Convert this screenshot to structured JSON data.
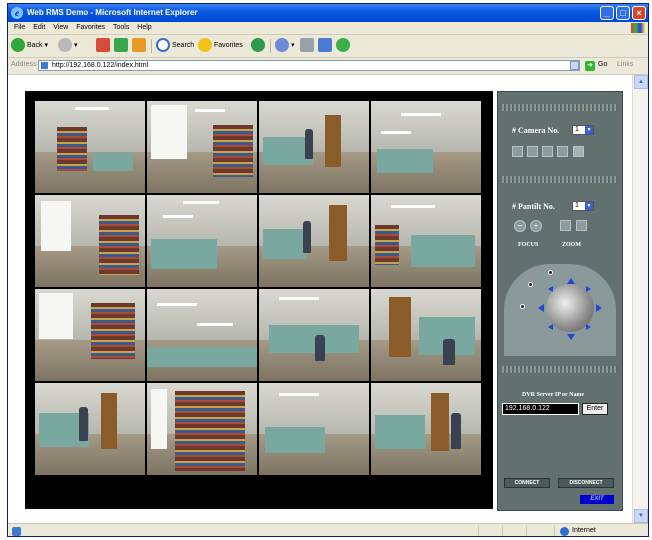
{
  "window": {
    "title": "Web RMS Demo - Microsoft Internet Explorer"
  },
  "menu": [
    "File",
    "Edit",
    "View",
    "Favorites",
    "Tools",
    "Help"
  ],
  "toolbar": {
    "back": "Back",
    "search": "Search",
    "favorites": "Favorites"
  },
  "address": {
    "label": "Address",
    "url": "http://192.168.0.122/index.html",
    "go": "Go",
    "links": "Links"
  },
  "control": {
    "camera_label": "# Camera No.",
    "camera_value": "1",
    "pantilt_label": "# Pantilt No.",
    "pantilt_value": "1",
    "focus": "FOCUS",
    "zoom": "ZOOM",
    "server_label": "DVR Server IP or Name",
    "server_value": "192.168.0.122",
    "enter": "Enter",
    "connect": "CONNECT",
    "disconnect": "DISCONNECT",
    "exit": "EXIT"
  },
  "status": {
    "zone": "Internet"
  },
  "colors": {
    "titlebar": "#0a5ae0",
    "panel": "#627070",
    "exit": "#0000cc"
  }
}
